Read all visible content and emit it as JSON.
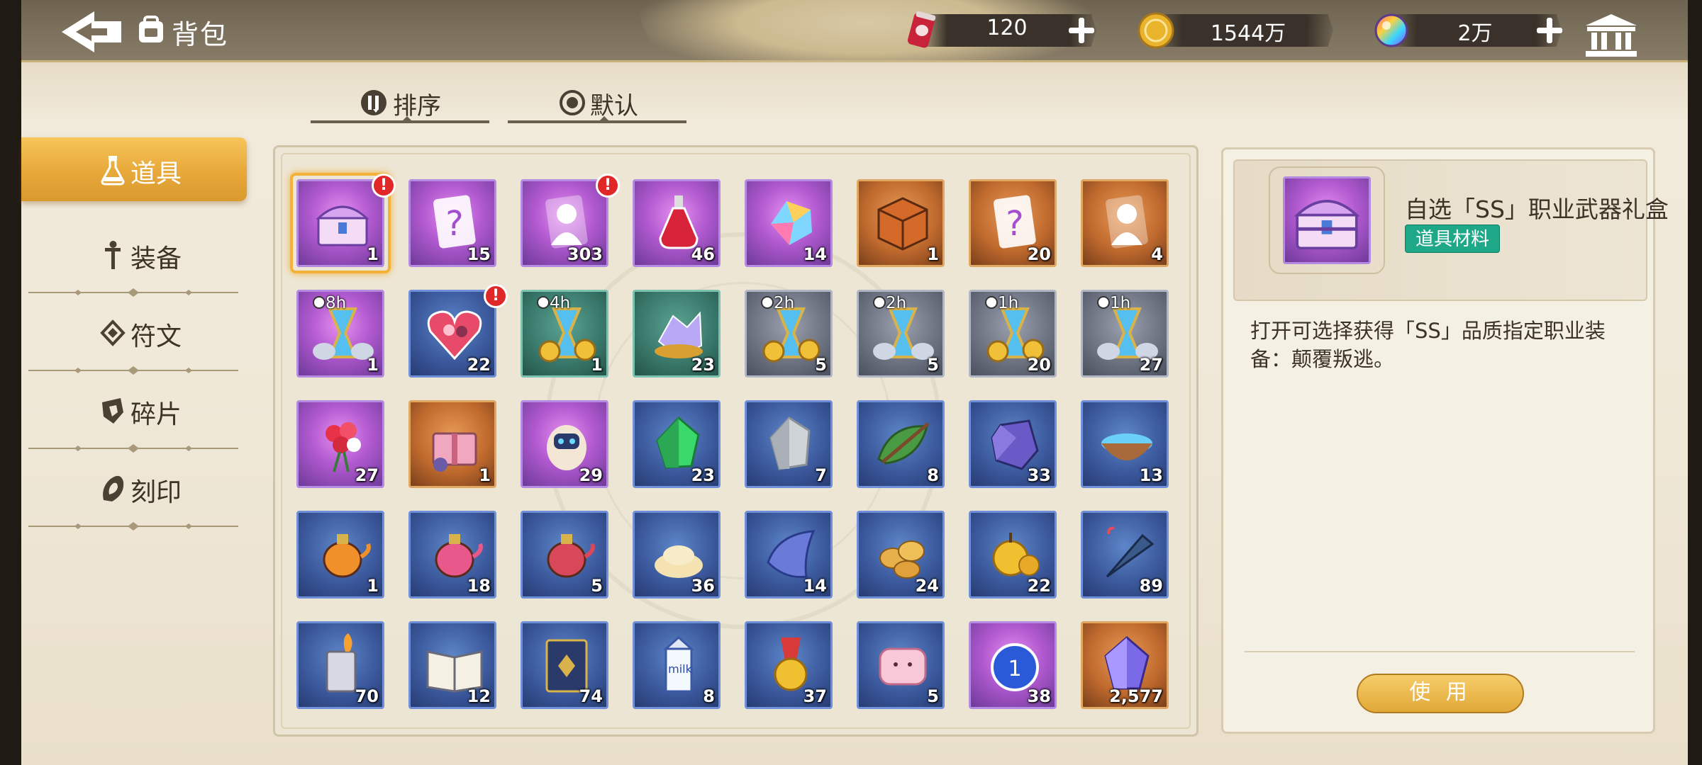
{
  "header": {
    "title": "背包",
    "resources": [
      {
        "name": "stamina-drink",
        "value": "120"
      },
      {
        "name": "gold-coin",
        "value": "1544万"
      },
      {
        "name": "rainbow-gem",
        "value": "2万"
      }
    ]
  },
  "sort": {
    "sort_label": "排序",
    "default_label": "默认"
  },
  "tabs": [
    {
      "label": "道具",
      "active": true
    },
    {
      "label": "装备",
      "active": false
    },
    {
      "label": "符文",
      "active": false
    },
    {
      "label": "碎片",
      "active": false
    },
    {
      "label": "刻印",
      "active": false
    }
  ],
  "grid": {
    "items": [
      {
        "icon": "ss-weapon-chest-icon",
        "quality": "purple",
        "count": "1",
        "alert": true,
        "selected": true
      },
      {
        "icon": "mystery-card-purple-icon",
        "quality": "purple",
        "count": "15"
      },
      {
        "icon": "character-card-purple-icon",
        "quality": "purple",
        "count": "303",
        "alert": true
      },
      {
        "icon": "red-potion-icon",
        "quality": "purple",
        "count": "46"
      },
      {
        "icon": "rainbow-crystal-icon",
        "quality": "purple",
        "count": "14"
      },
      {
        "icon": "orange-crate-icon",
        "quality": "orange",
        "count": "1"
      },
      {
        "icon": "mystery-card-orange-icon",
        "quality": "orange",
        "count": "20"
      },
      {
        "icon": "character-card-orange-icon",
        "quality": "orange",
        "count": "4"
      },
      {
        "icon": "purple-hourglass-stones-icon",
        "quality": "purple",
        "count": "1",
        "time": "8h"
      },
      {
        "icon": "heart-gift-box-icon",
        "quality": "blue",
        "count": "22",
        "alert": true
      },
      {
        "icon": "hourglass-coins-icon",
        "quality": "green",
        "count": "1",
        "time": "4h"
      },
      {
        "icon": "crystal-cluster-icon",
        "quality": "green",
        "count": "23"
      },
      {
        "icon": "hourglass-coins-icon",
        "quality": "grey",
        "count": "5",
        "time": "2h"
      },
      {
        "icon": "purple-hourglass-stones-icon",
        "quality": "grey",
        "count": "5",
        "time": "2h"
      },
      {
        "icon": "hourglass-coins-icon",
        "quality": "grey",
        "count": "20",
        "time": "1h"
      },
      {
        "icon": "purple-hourglass-stones-icon",
        "quality": "grey",
        "count": "27",
        "time": "1h"
      },
      {
        "icon": "flower-bouquet-icon",
        "quality": "purple",
        "count": "27"
      },
      {
        "icon": "pink-gift-box-icon",
        "quality": "orange",
        "count": "1"
      },
      {
        "icon": "robot-egg-icon",
        "quality": "purple",
        "count": "29"
      },
      {
        "icon": "green-crystal-icon",
        "quality": "blue",
        "count": "23"
      },
      {
        "icon": "grey-crystal-icon",
        "quality": "blue",
        "count": "7"
      },
      {
        "icon": "leaf-branch-icon",
        "quality": "blue",
        "count": "8"
      },
      {
        "icon": "purple-ore-icon",
        "quality": "blue",
        "count": "33"
      },
      {
        "icon": "water-bowl-icon",
        "quality": "blue",
        "count": "13"
      },
      {
        "icon": "orange-teapot-icon",
        "quality": "blue",
        "count": "1"
      },
      {
        "icon": "pink-teapot-icon",
        "quality": "blue",
        "count": "18"
      },
      {
        "icon": "red-jar-icon",
        "quality": "blue",
        "count": "5"
      },
      {
        "icon": "grain-pile-icon",
        "quality": "blue",
        "count": "36"
      },
      {
        "icon": "blue-cloth-icon",
        "quality": "blue",
        "count": "14"
      },
      {
        "icon": "potato-pile-icon",
        "quality": "blue",
        "count": "24"
      },
      {
        "icon": "golden-apple-icon",
        "quality": "blue",
        "count": "22"
      },
      {
        "icon": "umbrella-icon",
        "quality": "blue",
        "count": "89"
      },
      {
        "icon": "lighter-icon",
        "quality": "blue",
        "count": "70"
      },
      {
        "icon": "open-book-icon",
        "quality": "blue",
        "count": "12"
      },
      {
        "icon": "blue-tome-icon",
        "quality": "blue",
        "count": "74"
      },
      {
        "icon": "milk-carton-icon",
        "quality": "blue",
        "count": "8"
      },
      {
        "icon": "gold-medal-icon",
        "quality": "blue",
        "count": "37"
      },
      {
        "icon": "pink-pillow-icon",
        "quality": "blue",
        "count": "5"
      },
      {
        "icon": "blue-chip-icon",
        "quality": "purple",
        "count": "38"
      },
      {
        "icon": "purple-gem-icon",
        "quality": "orange",
        "count": "2,577"
      }
    ]
  },
  "detail": {
    "name": "自选「SS」职业武器礼盒",
    "tag": "道具材料",
    "tag_color": "#1ea888",
    "description": "打开可选择获得「SS」品质指定职业装备：颠覆叛逃。",
    "use_label": "使 用"
  },
  "colors": {
    "accent": "#e8a83a",
    "topbar": "#7d725e",
    "alert": "#e02828"
  }
}
